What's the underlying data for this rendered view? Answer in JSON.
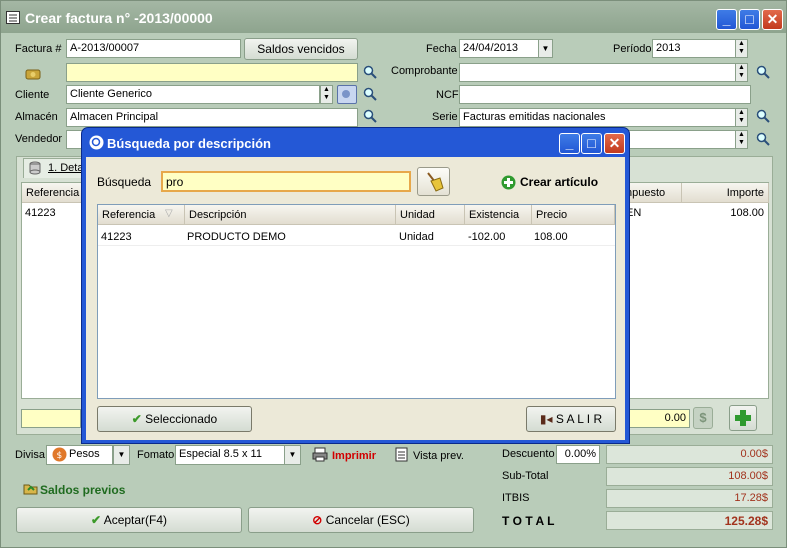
{
  "window": {
    "title": "Crear factura n° -2013/00000"
  },
  "form": {
    "factura_label": "Factura #",
    "factura_value": "A-2013/00007",
    "saldos_vencidos_button": "Saldos vencidos",
    "fecha_label": "Fecha",
    "fecha_value": "24/04/2013",
    "periodo_label": "Período",
    "periodo_value": "2013",
    "comprobante_label": "Comprobante",
    "comprobante_value": "",
    "cliente_label": "Cliente",
    "cliente_value": "Cliente Generico",
    "ncf_label": "NCF",
    "ncf_value": "",
    "almacen_label": "Almacén",
    "almacen_value": "Almacen Principal",
    "serie_label": "Serie",
    "serie_value": "Facturas emitidas nacionales",
    "vendedor_label": "Vendedor",
    "vendedor_value": ""
  },
  "details": {
    "tab_label": "1. Deta",
    "columns": {
      "referencia": "Referencia",
      "impuesto": "npuesto",
      "importe": "Importe"
    },
    "row": {
      "referencia": "41223",
      "impuesto": "EN",
      "importe": "108.00"
    },
    "footer_total": "0.00"
  },
  "bottom": {
    "divisa_label": "Divisa",
    "divisa_value": "Pesos",
    "formato_label": "Fomato",
    "formato_value": "Especial 8.5 x 11",
    "imprimir_label": "Imprimir",
    "vista_prev_label": "Vista prev.",
    "saldos_previos_label": "Saldos previos",
    "aceptar_button": "Aceptar(F4)",
    "cancelar_button": "Cancelar (ESC)"
  },
  "totals": {
    "descuento_label": "Descuento",
    "descuento_percent": "0.00%",
    "descuento_value": "0.00$",
    "subtotal_label": "Sub-Total",
    "subtotal_value": "108.00$",
    "itbis_label": "ITBIS",
    "itbis_value": "17.28$",
    "total_label": "T O T A L",
    "total_value": "125.28$"
  },
  "dialog": {
    "title": "Búsqueda por descripción",
    "search_label": "Búsqueda",
    "search_value": "pro",
    "crear_articulo_label": "Crear artículo",
    "columns": [
      "Referencia",
      "Descripción",
      "Unidad",
      "Existencia",
      "Precio"
    ],
    "rows": [
      {
        "referencia": "41223",
        "descripcion": "PRODUCTO DEMO",
        "unidad": "Unidad",
        "existencia": "-102.00",
        "precio": "108.00"
      }
    ],
    "seleccionado_button": "Seleccionado",
    "salir_button": "S A L I R"
  },
  "colors": {
    "title_bar": "#9aae9a",
    "dialog_bar": "#2458d6",
    "total_red": "#a2331d",
    "yellow_field": "#ffffc4"
  }
}
